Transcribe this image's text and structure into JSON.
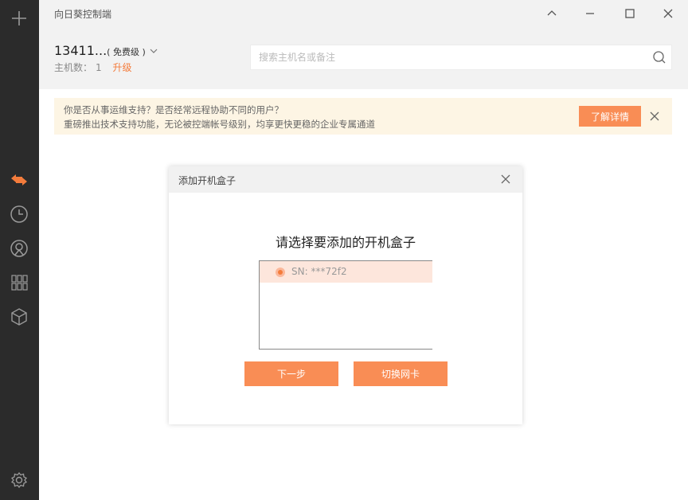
{
  "app": {
    "title": "向日葵控制端"
  },
  "account": {
    "id": "13411...",
    "tier": "( 免费级 )"
  },
  "hosts": {
    "label": "主机数：",
    "count": "1",
    "upgrade_label": "升级"
  },
  "search": {
    "placeholder": "搜索主机名或备注"
  },
  "notice": {
    "line1": "你是否从事运维支持？是否经常远程协助不同的用户？",
    "line2": "重磅推出技术支持功能，无论被控端帐号级别，均享更快更稳的企业专属通道",
    "button_label": "了解详情"
  },
  "dialog": {
    "title": "添加开机盒子",
    "heading": "请选择要添加的开机盒子",
    "items": [
      {
        "sn": "SN: ***72f2"
      }
    ],
    "next_label": "下一步",
    "switch_label": "切换网卡"
  },
  "colors": {
    "accent": "#f98d55",
    "sidebar": "#2b2b2b",
    "notice_bg": "#fdf5e4",
    "selected_bg": "#fde6dc"
  },
  "icons": [
    "add-icon",
    "remote-control-icon",
    "history-icon",
    "discovery-icon",
    "apps-icon",
    "box-icon",
    "settings-icon",
    "minimize-icon",
    "maximize-icon",
    "close-icon",
    "chevron-up-icon",
    "chevron-down-icon",
    "search-icon"
  ]
}
